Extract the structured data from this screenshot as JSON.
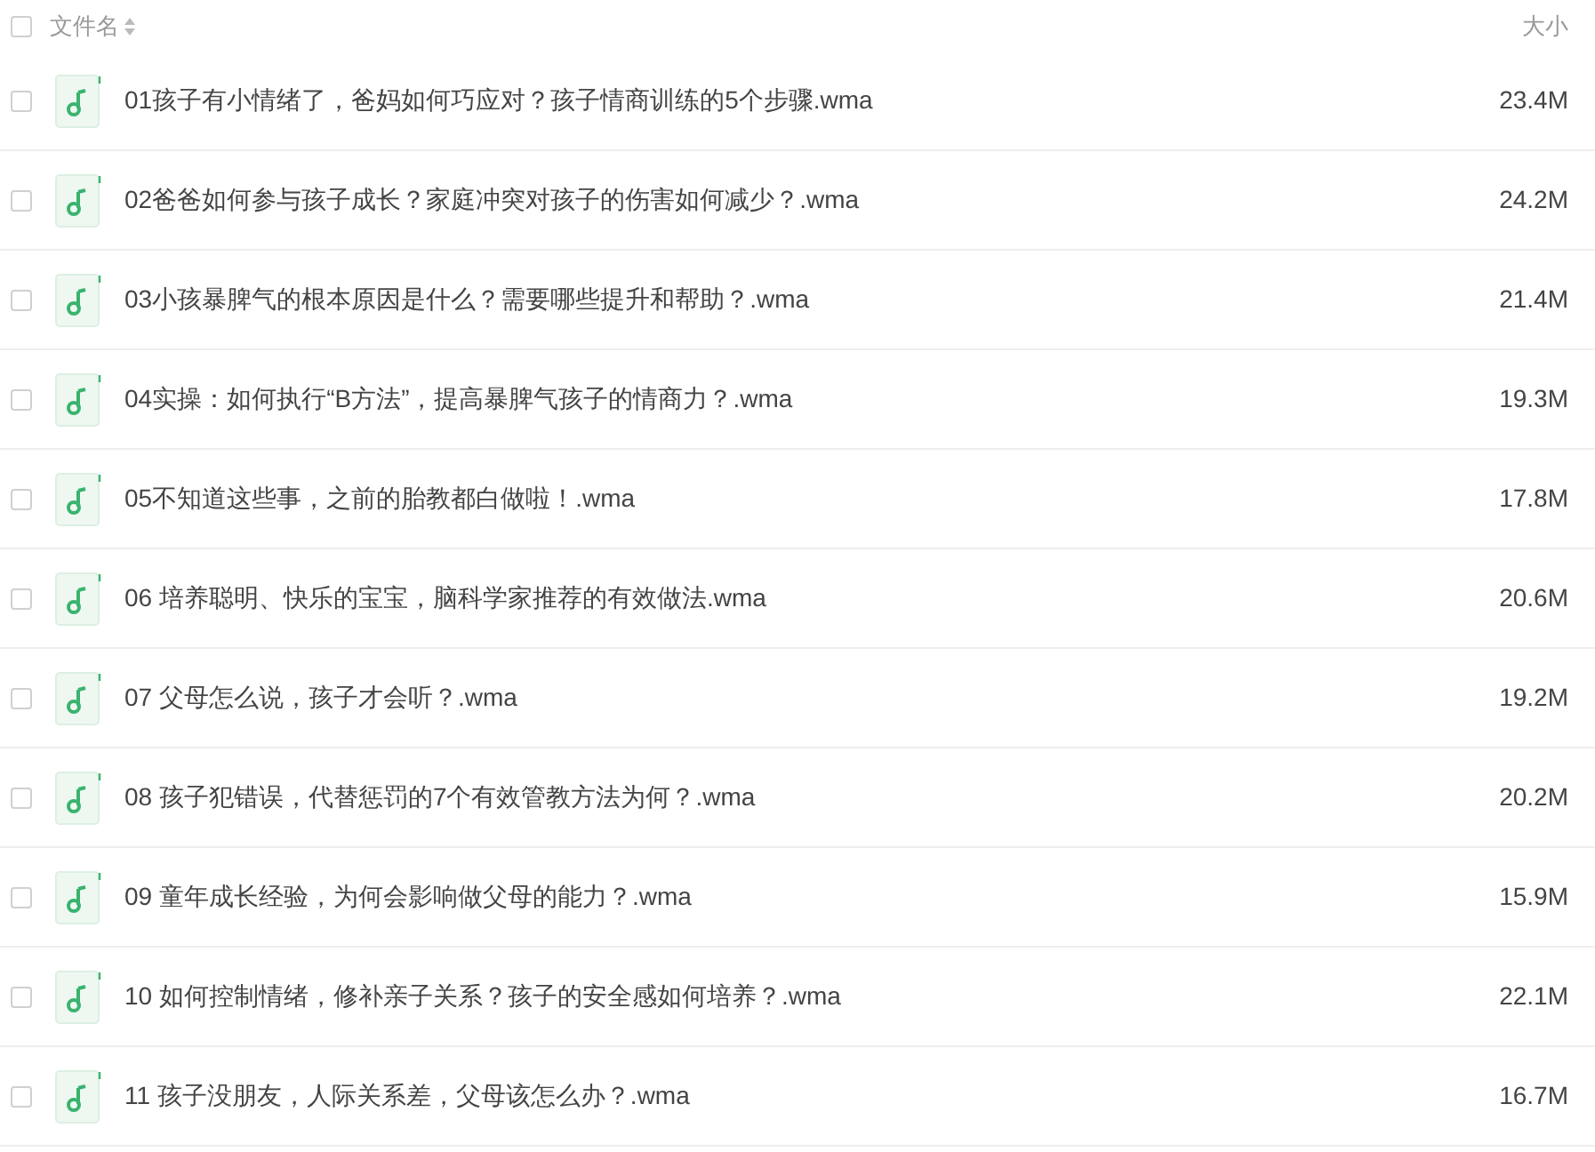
{
  "header": {
    "checked": false,
    "name_label": "文件名",
    "size_label": "大小"
  },
  "files": [
    {
      "checked": false,
      "name": "01孩子有小情绪了，爸妈如何巧应对？孩子情商训练的5个步骤.wma",
      "size": "23.4M"
    },
    {
      "checked": false,
      "name": "02爸爸如何参与孩子成长？家庭冲突对孩子的伤害如何减少？.wma",
      "size": "24.2M"
    },
    {
      "checked": false,
      "name": "03小孩暴脾气的根本原因是什么？需要哪些提升和帮助？.wma",
      "size": "21.4M"
    },
    {
      "checked": false,
      "name": "04实操：如何执行“B方法”，提高暴脾气孩子的情商力？.wma",
      "size": "19.3M"
    },
    {
      "checked": false,
      "name": "05不知道这些事，之前的胎教都白做啦！.wma",
      "size": "17.8M"
    },
    {
      "checked": false,
      "name": "06 培养聪明、快乐的宝宝，脑科学家推荐的有效做法.wma",
      "size": "20.6M"
    },
    {
      "checked": false,
      "name": "07 父母怎么说，孩子才会听？.wma",
      "size": "19.2M"
    },
    {
      "checked": false,
      "name": "08 孩子犯错误，代替惩罚的7个有效管教方法为何？.wma",
      "size": "20.2M"
    },
    {
      "checked": false,
      "name": "09 童年成长经验，为何会影响做父母的能力？.wma",
      "size": "15.9M"
    },
    {
      "checked": false,
      "name": "10 如何控制情绪，修补亲子关系？孩子的安全感如何培养？.wma",
      "size": "22.1M"
    },
    {
      "checked": false,
      "name": "11 孩子没朋友，人际关系差，父母该怎么办？.wma",
      "size": "16.7M"
    }
  ]
}
